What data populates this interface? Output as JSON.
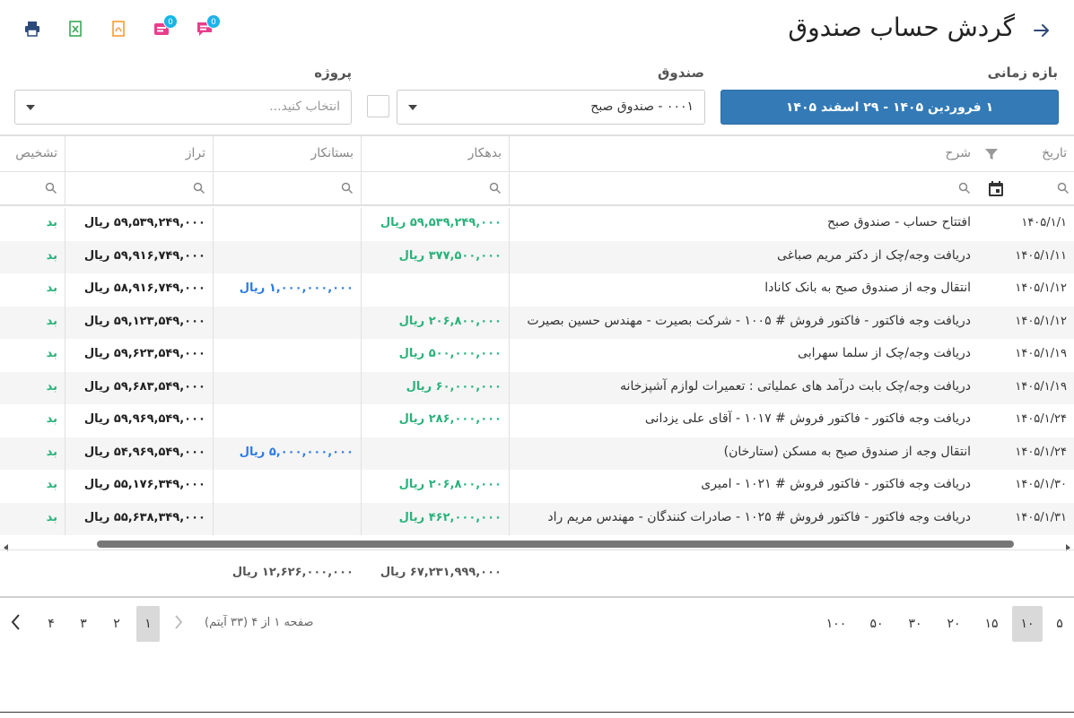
{
  "header": {
    "title": "گردش حساب صندوق"
  },
  "toolbar": {
    "icons": [
      "printer-icon",
      "excel-icon",
      "pdf-icon",
      "inbox-icon",
      "chat-icon"
    ],
    "badge_inbox": "0",
    "badge_chat": "0"
  },
  "filters": {
    "date_label": "بازه زمانی",
    "date_value": "۱ فروردین ۱۴۰۵ - ۲۹ اسفند ۱۴۰۵",
    "fund_label": "صندوق",
    "fund_value": "۰۰۰۱ - صندوق صبح",
    "project_label": "پروژه",
    "project_placeholder": "انتخاب کنید..."
  },
  "grid": {
    "columns": {
      "date": "تاریخ",
      "desc": "شرح",
      "debit": "بدهکار",
      "credit": "بستانکار",
      "balance": "تراز",
      "status": "تشخیص"
    },
    "rows": [
      {
        "date": "۱۴۰۵/۱/۱",
        "desc": "افتتاح حساب - صندوق صبح",
        "debit": "۵۹,۵۳۹,۲۴۹,۰۰۰ ریال",
        "credit": "",
        "balance": "۵۹,۵۳۹,۲۴۹,۰۰۰ ریال",
        "status": "بد"
      },
      {
        "date": "۱۴۰۵/۱/۱۱",
        "desc": "دریافت وجه/چک از دکتر مریم صباغی",
        "debit": "۳۷۷,۵۰۰,۰۰۰ ریال",
        "credit": "",
        "balance": "۵۹,۹۱۶,۷۴۹,۰۰۰ ریال",
        "status": "بد"
      },
      {
        "date": "۱۴۰۵/۱/۱۲",
        "desc": "انتقال وجه از صندوق صبح به بانک کانادا",
        "debit": "",
        "credit": "۱,۰۰۰,۰۰۰,۰۰۰ ریال",
        "balance": "۵۸,۹۱۶,۷۴۹,۰۰۰ ریال",
        "status": "بد"
      },
      {
        "date": "۱۴۰۵/۱/۱۲",
        "desc": "دریافت وجه فاکتور - فاکتور فروش # ۱۰۰۵ - شرکت بصیرت - مهندس حسین بصیرت",
        "debit": "۲۰۶,۸۰۰,۰۰۰ ریال",
        "credit": "",
        "balance": "۵۹,۱۲۳,۵۴۹,۰۰۰ ریال",
        "status": "بد"
      },
      {
        "date": "۱۴۰۵/۱/۱۹",
        "desc": "دریافت وجه/چک از سلما سهرابی",
        "debit": "۵۰۰,۰۰۰,۰۰۰ ریال",
        "credit": "",
        "balance": "۵۹,۶۲۳,۵۴۹,۰۰۰ ریال",
        "status": "بد"
      },
      {
        "date": "۱۴۰۵/۱/۱۹",
        "desc": "دریافت وجه/چک بابت درآمد های عملیاتی : تعمیرات لوازم آشپزخانه",
        "debit": "۶۰,۰۰۰,۰۰۰ ریال",
        "credit": "",
        "balance": "۵۹,۶۸۳,۵۴۹,۰۰۰ ریال",
        "status": "بد"
      },
      {
        "date": "۱۴۰۵/۱/۲۴",
        "desc": "دریافت وجه فاکتور - فاکتور فروش # ۱۰۱۷ - آقای علی یزدانی",
        "debit": "۲۸۶,۰۰۰,۰۰۰ ریال",
        "credit": "",
        "balance": "۵۹,۹۶۹,۵۴۹,۰۰۰ ریال",
        "status": "بد"
      },
      {
        "date": "۱۴۰۵/۱/۲۴",
        "desc": "انتقال وجه از صندوق صبح به مسکن (ستارخان)",
        "debit": "",
        "credit": "۵,۰۰۰,۰۰۰,۰۰۰ ریال",
        "balance": "۵۴,۹۶۹,۵۴۹,۰۰۰ ریال",
        "status": "بد"
      },
      {
        "date": "۱۴۰۵/۱/۳۰",
        "desc": "دریافت وجه فاکتور - فاکتور فروش # ۱۰۲۱ - امیری",
        "debit": "۲۰۶,۸۰۰,۰۰۰ ریال",
        "credit": "",
        "balance": "۵۵,۱۷۶,۳۴۹,۰۰۰ ریال",
        "status": "بد"
      },
      {
        "date": "۱۴۰۵/۱/۳۱",
        "desc": "دریافت وجه فاکتور - فاکتور فروش # ۱۰۲۵ - صادرات کنندگان - مهندس مریم راد",
        "debit": "۴۶۲,۰۰۰,۰۰۰ ریال",
        "credit": "",
        "balance": "۵۵,۶۳۸,۳۴۹,۰۰۰ ریال",
        "status": "بد"
      }
    ],
    "totals": {
      "debit": "۶۷,۲۳۱,۹۹۹,۰۰۰ ریال",
      "credit": "۱۲,۶۲۶,۰۰۰,۰۰۰ ریال"
    }
  },
  "pager": {
    "page_sizes": [
      "۵",
      "۱۰",
      "۱۵",
      "۲۰",
      "۳۰",
      "۵۰",
      "۱۰۰"
    ],
    "active_size": "۱۰",
    "info": "صفحه ۱ از ۴ (۳۳ آیتم)",
    "pages": [
      "۱",
      "۲",
      "۳",
      "۴"
    ],
    "active_page": "۱"
  },
  "colors": {
    "primary": "#337ab7",
    "debit": "#2ab27b",
    "credit": "#2c7be5",
    "badge": "#1ab4e8",
    "print_icon": "#2c4a7a",
    "excel_icon": "#3aa856",
    "pdf_icon": "#f39c33",
    "inbox_icon": "#e83e8c",
    "chat_icon": "#e83e8c"
  }
}
